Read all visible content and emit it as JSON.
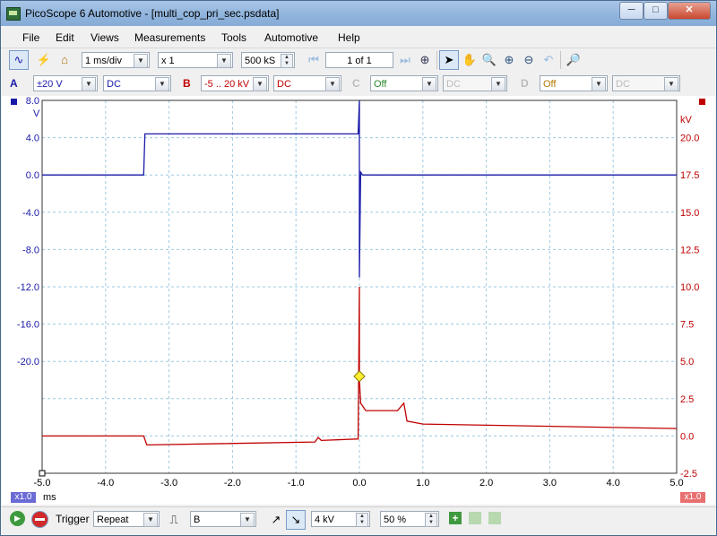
{
  "window": {
    "title": "PicoScope 6 Automotive - [multi_cop_pri_sec.psdata]",
    "controls": {
      "minimize": "─",
      "maximize": "□",
      "close": "✕"
    }
  },
  "menu": [
    "File",
    "Edit",
    "Views",
    "Measurements",
    "Tools",
    "Automotive",
    "Help"
  ],
  "toolbar": {
    "timebase": "1 ms/div",
    "zoom": "x 1",
    "samples": "500 kS",
    "buffer": "1 of 1"
  },
  "channels": {
    "a": {
      "name": "A",
      "range": "±20 V",
      "coupling": "DC",
      "color": "#1a1aa8"
    },
    "b": {
      "name": "B",
      "range": "-5 .. 20 kV",
      "coupling": "DC",
      "color": "#c00000"
    },
    "c": {
      "name": "C",
      "range": "Off",
      "coupling": "DC"
    },
    "d": {
      "name": "D",
      "range": "Off",
      "coupling": "DC"
    }
  },
  "plot": {
    "left_unit": "V",
    "right_unit": "kV",
    "left_ticks": [
      "8.0",
      "4.0",
      "0.0",
      "-4.0",
      "-8.0",
      "-12.0",
      "-16.0",
      "-20.0"
    ],
    "right_ticks": [
      "20.0",
      "17.5",
      "15.0",
      "12.5",
      "10.0",
      "7.5",
      "5.0",
      "2.5",
      "0.0",
      "-2.5"
    ],
    "x_ticks": [
      "-5.0",
      "-4.0",
      "-3.0",
      "-2.0",
      "-1.0",
      "0.0",
      "1.0",
      "2.0",
      "3.0",
      "4.0",
      "5.0"
    ],
    "x_unit": "ms",
    "left_zoom": "x1.0",
    "right_zoom": "x1.0"
  },
  "chart_data": {
    "type": "line",
    "x_unit": "ms",
    "xlim": [
      -5,
      5
    ],
    "series": [
      {
        "name": "A",
        "unit": "V",
        "ylim": [
          -24,
          8
        ],
        "x": [
          -5,
          -3.4,
          -3.38,
          -0.02,
          0.0,
          0.0,
          0.02,
          0.05,
          5
        ],
        "y": [
          0.0,
          0.0,
          4.4,
          4.4,
          8.0,
          -11.0,
          0.3,
          0.0,
          0.0
        ]
      },
      {
        "name": "B",
        "unit": "kV",
        "ylim": [
          -2.5,
          20
        ],
        "x": [
          -5,
          -3.4,
          -3.35,
          -0.7,
          -0.65,
          -0.6,
          -0.02,
          0.0,
          0.0,
          0.02,
          0.1,
          0.6,
          0.7,
          0.75,
          1.0,
          5
        ],
        "y": [
          0.0,
          0.0,
          -0.6,
          -0.4,
          -0.1,
          -0.3,
          -0.2,
          10.0,
          3.8,
          2.2,
          1.7,
          1.7,
          2.2,
          1.0,
          0.8,
          0.5
        ]
      }
    ],
    "trigger_marker": {
      "x": 0.0,
      "channel": "B",
      "value": 4.0
    }
  },
  "status": {
    "trigger_label": "Trigger",
    "trigger_mode": "Repeat",
    "trigger_channel": "B",
    "threshold": "4 kV",
    "pretrigger": "50 %"
  }
}
